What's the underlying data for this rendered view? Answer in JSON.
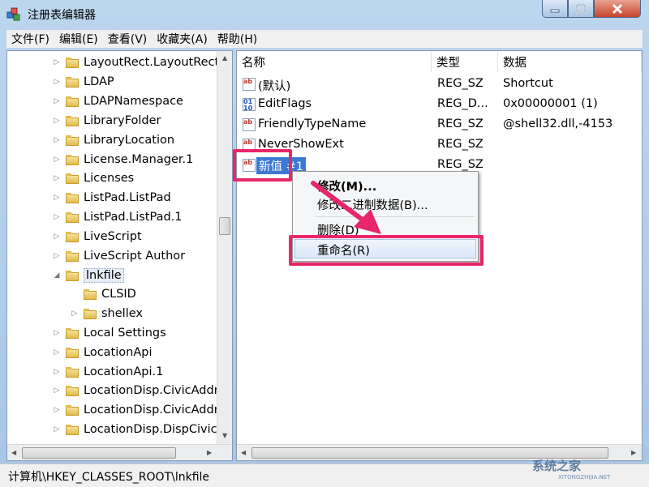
{
  "window": {
    "title": "注册表编辑器"
  },
  "menu": [
    "文件(F)",
    "编辑(E)",
    "查看(V)",
    "收藏夹(A)",
    "帮助(H)"
  ],
  "tree": {
    "items": [
      {
        "label": "LayoutRect.LayoutRect"
      },
      {
        "label": "LDAP"
      },
      {
        "label": "LDAPNamespace"
      },
      {
        "label": "LibraryFolder"
      },
      {
        "label": "LibraryLocation"
      },
      {
        "label": "License.Manager.1"
      },
      {
        "label": "Licenses"
      },
      {
        "label": "ListPad.ListPad"
      },
      {
        "label": "ListPad.ListPad.1"
      },
      {
        "label": "LiveScript"
      },
      {
        "label": "LiveScript Author"
      },
      {
        "label": "lnkfile"
      },
      {
        "label": "CLSID"
      },
      {
        "label": "shellex"
      },
      {
        "label": "Local Settings"
      },
      {
        "label": "LocationApi"
      },
      {
        "label": "LocationApi.1"
      },
      {
        "label": "LocationDisp.CivicAddr"
      },
      {
        "label": "LocationDisp.CivicAddr"
      },
      {
        "label": "LocationDisp.DispCivic"
      }
    ]
  },
  "columns": {
    "name": "名称",
    "type": "类型",
    "data": "数据"
  },
  "values": [
    {
      "name": "(默认)",
      "type": "REG_SZ",
      "data": "Shortcut",
      "icon": "ab"
    },
    {
      "name": "EditFlags",
      "type": "REG_D...",
      "data": "0x00000001 (1)",
      "icon": "bin"
    },
    {
      "name": "FriendlyTypeName",
      "type": "REG_SZ",
      "data": "@shell32.dll,-4153",
      "icon": "ab"
    },
    {
      "name": "NeverShowExt",
      "type": "REG_SZ",
      "data": "",
      "icon": "ab"
    },
    {
      "name": "新值 #1",
      "type": "REG_SZ",
      "data": "",
      "icon": "ab"
    }
  ],
  "context_menu": {
    "modify": "修改(M)...",
    "modify_binary": "修改二进制数据(B)...",
    "delete": "删除(D)",
    "rename": "重命名(R)"
  },
  "status": {
    "path": "计算机\\HKEY_CLASSES_ROOT\\lnkfile"
  },
  "watermark": {
    "brand": "系统之家",
    "site": "XITONGZHIJIA.NET"
  },
  "colors": {
    "annotation": "#e8266a",
    "selection": "#3b79d3"
  }
}
